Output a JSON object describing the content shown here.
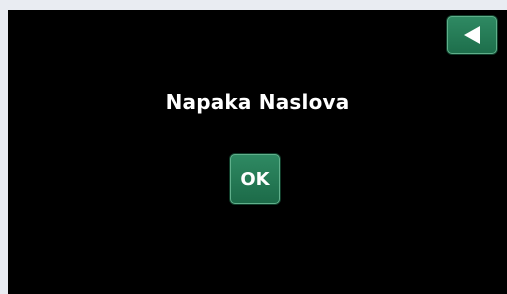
{
  "header": {
    "back_icon": "back-triangle-icon"
  },
  "dialog": {
    "title": "Napaka Naslova",
    "ok_label": "OK"
  },
  "colors": {
    "background": "#000000",
    "button_green": "#2a7f5a",
    "text": "#ffffff"
  }
}
